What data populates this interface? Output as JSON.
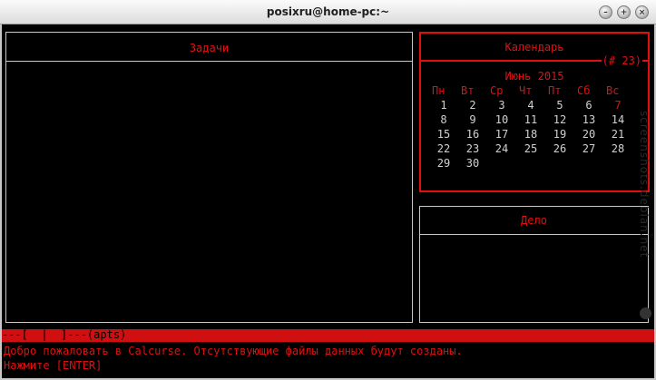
{
  "window": {
    "title": "posixru@home-pc:~"
  },
  "panels": {
    "tasks_title": "Задачи",
    "calendar_title": "Календарь",
    "calendar_badge": "(# 23)",
    "events_title": "Дело"
  },
  "calendar": {
    "month_label": "Июнь 2015",
    "weekdays": [
      "Пн",
      "Вт",
      "Ср",
      "Чт",
      "Пт",
      "Сб",
      "Вс"
    ],
    "weeks": [
      [
        "1",
        "2",
        "3",
        "4",
        "5",
        "6",
        "7"
      ],
      [
        "8",
        "9",
        "10",
        "11",
        "12",
        "13",
        "14"
      ],
      [
        "15",
        "16",
        "17",
        "18",
        "19",
        "20",
        "21"
      ],
      [
        "22",
        "23",
        "24",
        "25",
        "26",
        "27",
        "28"
      ],
      [
        "29",
        "30",
        "",
        "",
        "",
        "",
        ""
      ]
    ],
    "highlighted_day": "7"
  },
  "statusbar": {
    "text": "---[  |  ]---(apts)"
  },
  "messages": {
    "line1": "Добро пожаловать в Calcurse. Отсутствующие файлы данных будут созданы.",
    "line2": "Нажмите [ENTER]"
  },
  "watermark": "screenshots.debian.net",
  "colors": {
    "accent": "#e01010",
    "border": "#c8c8c8",
    "background": "#000000"
  }
}
